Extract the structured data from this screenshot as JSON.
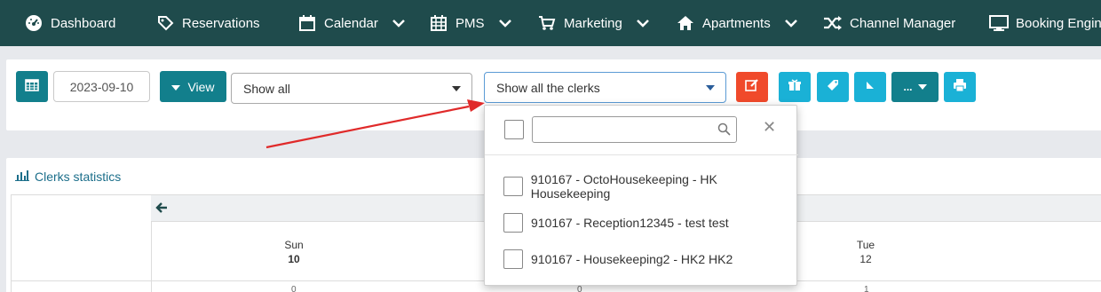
{
  "nav": {
    "items": [
      {
        "label": "Dashboard",
        "icon": "dashboard-gauge-icon",
        "has_chevron": false
      },
      {
        "label": "Reservations",
        "icon": "tag-icon",
        "has_chevron": false
      },
      {
        "label": "Calendar",
        "icon": "calendar-icon",
        "has_chevron": true
      },
      {
        "label": "PMS",
        "icon": "grid-calendar-icon",
        "has_chevron": true
      },
      {
        "label": "Marketing",
        "icon": "cart-icon",
        "has_chevron": true
      },
      {
        "label": "Apartments",
        "icon": "home-icon",
        "has_chevron": true
      },
      {
        "label": "Channel Manager",
        "icon": "shuffle-icon",
        "has_chevron": false
      },
      {
        "label": "Booking Engine D",
        "icon": "monitor-icon",
        "has_chevron": false
      }
    ]
  },
  "toolbar": {
    "date_value": "2023-09-10",
    "view_label": "View",
    "filter_select": "Show all",
    "clerk_select": "Show all the clerks"
  },
  "stats": {
    "title": "Clerks statistics",
    "days": [
      {
        "weekday": "Sun",
        "date": "10"
      },
      {
        "weekday": "Tue",
        "date": "12"
      }
    ],
    "values": [
      "0",
      "0",
      "1"
    ]
  },
  "dropdown": {
    "items": [
      "910167 - OctoHousekeeping - HK Housekeeping",
      "910167 - Reception12345 - test test",
      "910167 - Housekeeping2 - HK2 HK2"
    ]
  },
  "colors": {
    "nav_bg": "#1f4b4c",
    "teal": "#127f8c",
    "cyan": "#1ab1d6",
    "red": "#f04a2b",
    "arrow": "#e02a2a"
  }
}
